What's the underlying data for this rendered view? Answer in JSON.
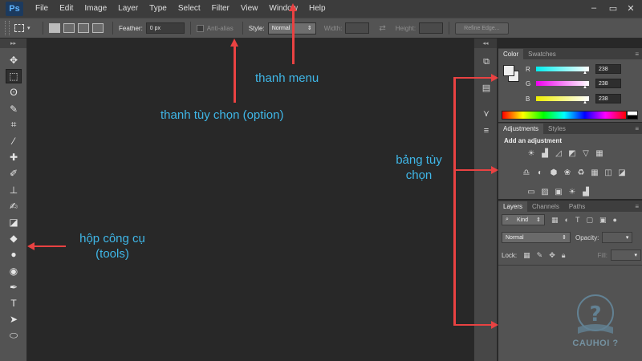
{
  "app": {
    "logo": "Ps",
    "menu": [
      "File",
      "Edit",
      "Image",
      "Layer",
      "Type",
      "Select",
      "Filter",
      "View",
      "Window",
      "Help"
    ],
    "window_controls": {
      "minimize": "–",
      "restore": "▭",
      "close": "✕"
    }
  },
  "options_bar": {
    "feather_label": "Feather:",
    "feather_value": "0 px",
    "antialias_label": "Anti-alias",
    "style_label": "Style:",
    "style_value": "Normal",
    "width_label": "Width:",
    "height_label": "Height:",
    "refine_edge_label": "Refine Edge..."
  },
  "toolbox": {
    "tools": [
      {
        "name": "move-tool",
        "glyph": "✥"
      },
      {
        "name": "marquee-tool",
        "glyph": "⬚",
        "active": true
      },
      {
        "name": "lasso-tool",
        "glyph": "ʘ"
      },
      {
        "name": "quick-selection-tool",
        "glyph": "✎"
      },
      {
        "name": "crop-tool",
        "glyph": "⌗"
      },
      {
        "name": "eyedropper-tool",
        "glyph": "⁄"
      },
      {
        "name": "healing-brush-tool",
        "glyph": "✚"
      },
      {
        "name": "brush-tool",
        "glyph": "✐"
      },
      {
        "name": "clone-stamp-tool",
        "glyph": "⊥"
      },
      {
        "name": "history-brush-tool",
        "glyph": "✍"
      },
      {
        "name": "eraser-tool",
        "glyph": "◪"
      },
      {
        "name": "paint-bucket-tool",
        "glyph": "◆"
      },
      {
        "name": "blur-tool",
        "glyph": "●"
      },
      {
        "name": "dodge-tool",
        "glyph": "◉"
      },
      {
        "name": "pen-tool",
        "glyph": "✒"
      },
      {
        "name": "type-tool",
        "glyph": "T"
      },
      {
        "name": "path-selection-tool",
        "glyph": "➤"
      },
      {
        "name": "ellipse-tool",
        "glyph": "⬭"
      }
    ]
  },
  "panels": {
    "color": {
      "tabs": [
        "Color",
        "Swatches"
      ],
      "r_label": "R",
      "g_label": "G",
      "b_label": "B",
      "r_value": "238",
      "g_value": "238",
      "b_value": "238"
    },
    "adjustments": {
      "tabs": [
        "Adjustments",
        "Styles"
      ],
      "heading": "Add an adjustment"
    },
    "layers": {
      "tabs": [
        "Layers",
        "Channels",
        "Paths"
      ],
      "filter_label": "Kind",
      "blend_mode": "Normal",
      "opacity_label": "Opacity:",
      "lock_label": "Lock:",
      "fill_label": "Fill:"
    }
  },
  "annotations": {
    "menu_bar": "thanh menu",
    "options_bar": "thanh tùy chọn (option)",
    "panels_line1": "bảng tùy",
    "panels_line2": "chọn",
    "tools_line1": "hộp công cụ",
    "tools_line2": "(tools)"
  },
  "watermark": {
    "text": "CAUHOI ?"
  },
  "colors": {
    "menubar_bg": "#3c3c3c",
    "panel_bg": "#535353",
    "canvas_bg": "#282828",
    "annotation_text": "#3fb7e8",
    "arrow": "#e94242"
  }
}
